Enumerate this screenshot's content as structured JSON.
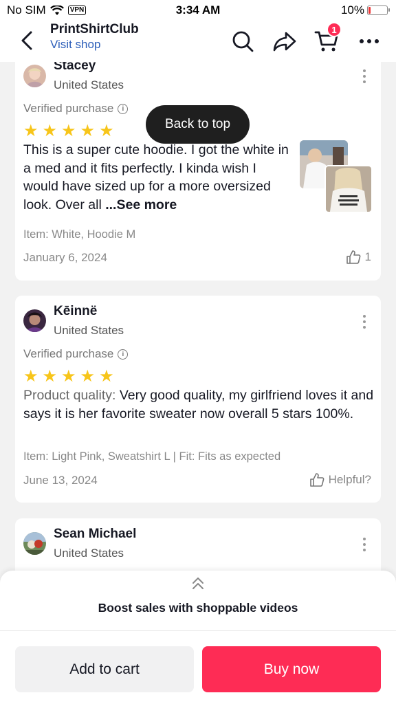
{
  "status_bar": {
    "carrier": "No SIM",
    "vpn": "VPN",
    "time": "3:34 AM",
    "battery": "10%",
    "battery_level": 0.1
  },
  "header": {
    "shop_name": "PrintShirtClub",
    "visit_shop": "Visit shop",
    "cart_count": "1"
  },
  "back_to_top": "Back to top",
  "reviews": [
    {
      "name": "Stacey",
      "country": "United States",
      "verified": "Verified purchase",
      "rating": 5,
      "text": "This is a super cute hoodie. I got the white in a med and it fits perfectly. I kinda wish I would have sized up for a more oversized look. Over all ",
      "see_more": "...See more",
      "item": "Item: White, Hoodie M",
      "date": "January 6, 2024",
      "helpful_count": "1"
    },
    {
      "name": "Kēinnë",
      "country": "United States",
      "verified": "Verified purchase",
      "rating": 5,
      "label": "Product quality:",
      "text": " Very good quality, my girlfriend loves it and says it is her favorite sweater now overall 5 stars 100%.",
      "item": "Item: Light Pink, Sweatshirt L | Fit: Fits as expected",
      "date": "June 13, 2024",
      "helpful_label": "Helpful?"
    },
    {
      "name": "Sean Michael",
      "country": "United States"
    }
  ],
  "bottom": {
    "boost": "Boost sales with shoppable videos",
    "add_to_cart": "Add to cart",
    "buy_now": "Buy now"
  },
  "colors": {
    "accent": "#fe2c55",
    "link": "#2b5db9",
    "star": "#f7c51a"
  }
}
